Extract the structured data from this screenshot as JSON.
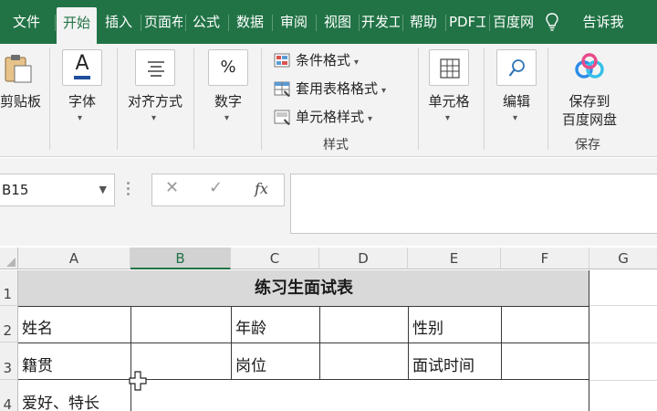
{
  "tabs": [
    {
      "label": "文件"
    },
    {
      "label": "开始",
      "active": true
    },
    {
      "label": "插入"
    },
    {
      "label": "页面布"
    },
    {
      "label": "公式"
    },
    {
      "label": "数据"
    },
    {
      "label": "审阅"
    },
    {
      "label": "视图"
    },
    {
      "label": "开发工"
    },
    {
      "label": "帮助"
    },
    {
      "label": "PDF工"
    },
    {
      "label": "百度网"
    },
    {
      "label": "告诉我"
    }
  ],
  "ribbon": {
    "clipboard_label": "剪贴板",
    "font_label": "字体",
    "font_icon_text": "A",
    "align_label": "对齐方式",
    "number_label": "数字",
    "number_icon_text": "%",
    "styles": {
      "conditional_format": "条件格式",
      "table_format": "套用表格格式",
      "cell_style": "单元格样式",
      "group_label": "样式"
    },
    "cells_label": "单元格",
    "edit_label": "编辑",
    "save_baidu_line1": "保存到",
    "save_baidu_line2": "百度网盘",
    "save_group_label": "保存"
  },
  "formula_bar": {
    "name_box": "B15",
    "cancel_symbol": "✕",
    "enter_symbol": "✓",
    "fx_symbol": "fx",
    "formula_value": ""
  },
  "grid": {
    "columns": [
      "A",
      "B",
      "C",
      "D",
      "E",
      "F",
      "G"
    ],
    "selected_column": "B",
    "rows": [
      "1",
      "2",
      "3",
      "4"
    ],
    "title": "练习生面试表",
    "cells": {
      "name": "姓名",
      "age": "年龄",
      "gender": "性别",
      "hometown": "籍贯",
      "position": "岗位",
      "interview_time": "面试时间",
      "hobbies": "爱好、特长"
    }
  },
  "colors": {
    "accent": "#217346",
    "ribbon_bg": "#f3f3f3",
    "title_fill": "#d9d9d9"
  }
}
